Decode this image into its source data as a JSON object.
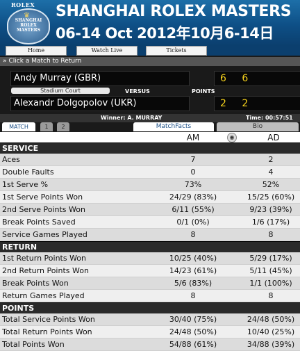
{
  "header": {
    "brand": "ROLEX",
    "logo_text": "Shanghai\nRolex\nMasters",
    "title": "SHANGHAI ROLEX MASTERS",
    "dates": "06-14 Oct 2012年10月6-14日"
  },
  "nav": {
    "items": [
      {
        "label": "Home"
      },
      {
        "label": "Watch Live"
      },
      {
        "label": "Tickets"
      }
    ]
  },
  "select_match": {
    "label": "Click a Match to Return",
    "icon": "double-chevron-icon"
  },
  "scoreboard": {
    "player1": {
      "name": "Andy Murray (GBR)",
      "sets": "6 6"
    },
    "player2": {
      "name": "Alexandr Dolgopolov (UKR)",
      "sets": "2 2"
    },
    "court": "Stadium Court",
    "versus": "VERSUS",
    "points_label": "POINTS",
    "winner": "Winner: A. MURRAY",
    "time": "Time: 00:57:51"
  },
  "tabs": {
    "match": "MATCH",
    "set1": "1",
    "set2": "2",
    "matchfacts": "MatchFacts",
    "bio": "Bio"
  },
  "columns": {
    "player1": "AM",
    "player2": "AD",
    "toggle_icon": "circle-toggle-icon"
  },
  "sections": [
    {
      "title": "SERVICE",
      "rows": [
        {
          "label": "Aces",
          "am": "7",
          "ad": "2"
        },
        {
          "label": "Double Faults",
          "am": "0",
          "ad": "4"
        },
        {
          "label": "1st Serve %",
          "am": "73%",
          "ad": "52%"
        },
        {
          "label": "1st Serve Points Won",
          "am": "24/29 (83%)",
          "ad": "15/25 (60%)"
        },
        {
          "label": "2nd Serve Points Won",
          "am": "6/11 (55%)",
          "ad": "9/23 (39%)"
        },
        {
          "label": "Break Points Saved",
          "am": "0/1 (0%)",
          "ad": "1/6 (17%)"
        },
        {
          "label": "Service Games Played",
          "am": "8",
          "ad": "8"
        }
      ]
    },
    {
      "title": "RETURN",
      "rows": [
        {
          "label": "1st Return Points Won",
          "am": "10/25 (40%)",
          "ad": "5/29 (17%)"
        },
        {
          "label": "2nd Return Points Won",
          "am": "14/23 (61%)",
          "ad": "5/11 (45%)"
        },
        {
          "label": "Break Points Won",
          "am": "5/6 (83%)",
          "ad": "1/1 (100%)"
        },
        {
          "label": "Return Games Played",
          "am": "8",
          "ad": "8"
        }
      ]
    },
    {
      "title": "POINTS",
      "rows": [
        {
          "label": "Total Service Points Won",
          "am": "30/40 (75%)",
          "ad": "24/48 (50%)"
        },
        {
          "label": "Total Return Points Won",
          "am": "24/48 (50%)",
          "ad": "10/40 (25%)"
        },
        {
          "label": "Total Points Won",
          "am": "54/88 (61%)",
          "ad": "34/88 (39%)"
        }
      ]
    }
  ],
  "colors": {
    "banner": "#0e4f86",
    "scores": "#f5d11c",
    "section_header": "#2a2a2a"
  }
}
